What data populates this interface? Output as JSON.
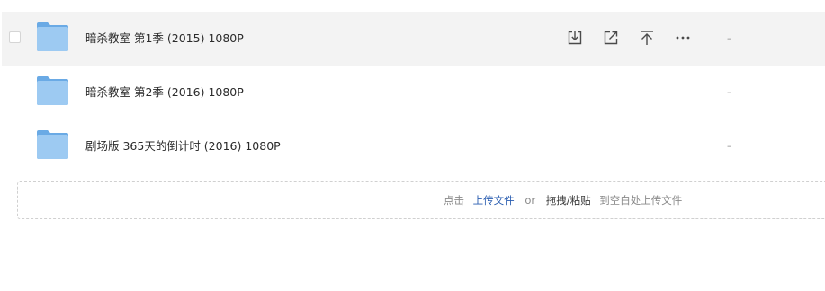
{
  "files": [
    {
      "name": "暗杀教室 第1季 (2015) 1080P",
      "size": "–"
    },
    {
      "name": "暗杀教室 第2季 (2016) 1080P",
      "size": "–"
    },
    {
      "name": "剧场版 365天的倒计时 (2016) 1080P",
      "size": "–"
    }
  ],
  "row_actions": [
    "download-icon",
    "share-icon",
    "move-to-top-icon",
    "more-icon"
  ],
  "upload_hint": {
    "prefix": "点击",
    "link": "上传文件",
    "or": "or",
    "drag": "拖拽/粘贴",
    "suffix": "到空白处上传文件"
  },
  "colors": {
    "folder": "#7fb8ea",
    "link": "#2a5db0",
    "row_hover": "#f3f3f3"
  }
}
